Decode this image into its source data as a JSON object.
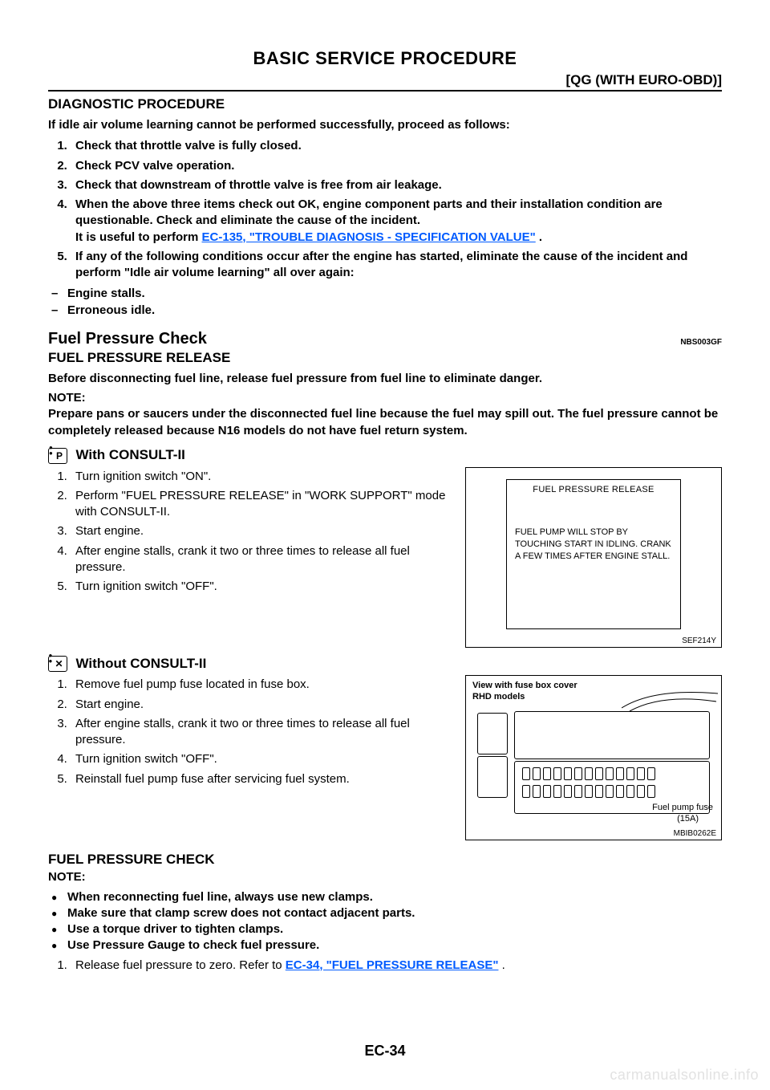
{
  "header": {
    "title": "BASIC SERVICE PROCEDURE",
    "right": "[QG (WITH EURO-OBD)]"
  },
  "diag_proc": {
    "heading": "DIAGNOSTIC PROCEDURE",
    "intro": "If idle air volume learning cannot be performed successfully, proceed as follows:",
    "steps": [
      "Check that throttle valve is fully closed.",
      "Check PCV valve operation.",
      "Check that downstream of throttle valve is free from air leakage.",
      "When the above three items check out OK, engine component parts and their installation condition are questionable. Check and eliminate the cause of the incident.",
      "If any of the following conditions occur after the engine has started, eliminate the cause of the incident and perform \"Idle air volume learning\" all over again:"
    ],
    "step4_lead": "It is useful to perform ",
    "step4_link": "EC-135, \"TROUBLE DIAGNOSIS - SPECIFICATION VALUE\"",
    "step4_after": " .",
    "dash_items": [
      "Engine stalls.",
      "Erroneous idle."
    ]
  },
  "fuel_pressure": {
    "heading": "Fuel Pressure Check",
    "ref": "NBS003GF",
    "sub": "FUEL PRESSURE RELEASE",
    "warn": "Before disconnecting fuel line, release fuel pressure from fuel line to eliminate danger.",
    "note_label": "NOTE:",
    "note": "Prepare pans or saucers under the disconnected fuel line because the fuel may spill out. The fuel pressure cannot be completely released because N16 models do not have fuel return system."
  },
  "with_consult": {
    "icon": "P",
    "heading": "With CONSULT-II",
    "steps": [
      "Turn ignition switch \"ON\".",
      "Perform \"FUEL PRESSURE RELEASE\" in \"WORK SUPPORT\" mode with CONSULT-II.",
      "Start engine.",
      "After engine stalls, crank it two or three times to release all fuel pressure.",
      "Turn ignition switch \"OFF\"."
    ]
  },
  "fig1": {
    "title": "FUEL PRESSURE RELEASE",
    "body": "FUEL PUMP WILL STOP BY TOUCHING START IN IDLING. CRANK A FEW TIMES AFTER ENGINE STALL.",
    "ref": "SEF214Y"
  },
  "without_consult": {
    "icon": "✕",
    "heading": "Without CONSULT-II",
    "steps": [
      "Remove fuel pump fuse located in fuse box.",
      "Start engine.",
      "After engine stalls, crank it two or three times to release all fuel pressure.",
      "Turn ignition switch \"OFF\".",
      "Reinstall fuel pump fuse after servicing fuel system."
    ]
  },
  "fig2": {
    "line1": "View with fuse box cover",
    "line2": "RHD models",
    "fuse_label": "Fuel pump fuse",
    "fuse_amp": "(15A)",
    "ref": "MBIB0262E"
  },
  "fuel_check": {
    "heading": "FUEL PRESSURE CHECK",
    "note_label": "NOTE:",
    "bullets": [
      "When reconnecting fuel line, always use new clamps.",
      "Make sure that clamp screw does not contact adjacent parts.",
      "Use a torque driver to tighten clamps.",
      "Use Pressure Gauge to check fuel pressure."
    ],
    "step_lead": "Release fuel pressure to zero. Refer to ",
    "step_link": "EC-34, \"FUEL PRESSURE RELEASE\"",
    "step_after": " ."
  },
  "footer": {
    "page": "EC-34",
    "watermark": "carmanualsonline.info"
  }
}
